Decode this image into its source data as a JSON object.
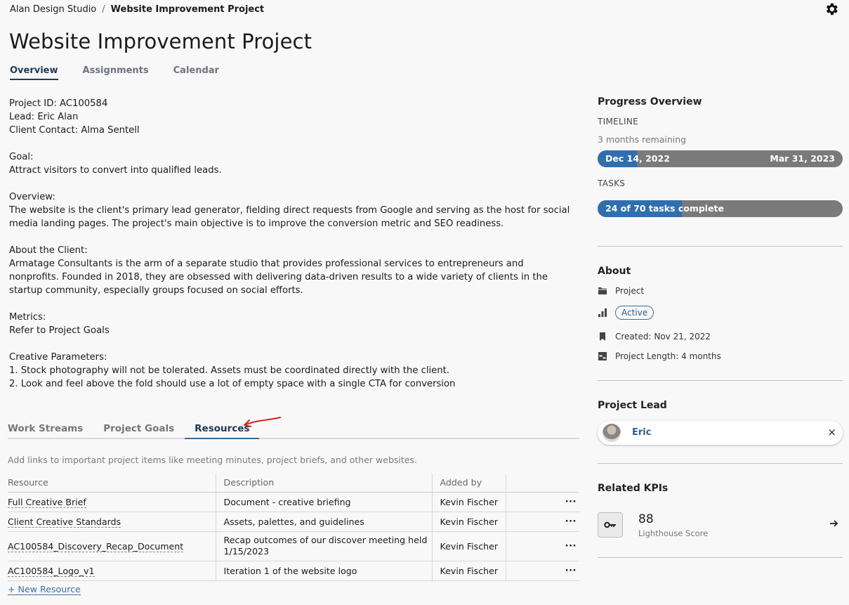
{
  "breadcrumb": {
    "studio": "Alan Design Studio",
    "separator": "/",
    "current": "Website Improvement Project"
  },
  "page_title": "Website Improvement Project",
  "top_tabs": [
    "Overview",
    "Assignments",
    "Calendar"
  ],
  "active_top_tab": "Overview",
  "description": {
    "project_id": "Project ID: AC100584",
    "lead": "Lead: Eric Alan",
    "client_contact": "Client Contact: Alma Sentell",
    "goal_label": "Goal:",
    "goal_text": "Attract visitors to convert into qualified leads.",
    "overview_label": "Overview:",
    "overview_text_1": "The website is the client's primary lead generator, fielding direct requests from Google and serving as the host for social",
    "overview_text_2": "media landing pages.  The project's main objective is to improve the conversion metric and SEO readiness.",
    "about_client_label": "About the Client:",
    "about_client_1": "Armatage Consultants is the arm of a separate studio that provides professional services to entrepreneurs and",
    "about_client_2": "nonprofits.  Founded in 2018, they are obsessed with delivering data-driven results to a wide variety of clients in the",
    "about_client_3": "startup community, especially groups focused on social efforts.",
    "metrics_label": "Metrics:",
    "metrics_text": "Refer to Project Goals",
    "creative_label": "Creative Parameters:",
    "creative_1": "1.  Stock photography will not be tolerated.  Assets must be coordinated directly with the client.",
    "creative_2": "2.  Look and feel above the fold should use a lot of empty space with a single CTA for conversion"
  },
  "sub_tabs": [
    "Work Streams",
    "Project Goals",
    "Resources"
  ],
  "active_sub_tab": "Resources",
  "resources": {
    "hint": "Add links to important project items like meeting minutes, project briefs, and other websites.",
    "columns": [
      "Resource",
      "Description",
      "Added by"
    ],
    "rows": [
      {
        "name": "Full Creative Brief",
        "description": "Document - creative briefing",
        "added_by": "Kevin Fischer",
        "menu": "···"
      },
      {
        "name": "Client Creative Standards",
        "description": "Assets, palettes, and guidelines",
        "added_by": "Kevin Fischer",
        "menu": "···"
      },
      {
        "name": "AC100584_Discovery_Recap_Document",
        "description_1": "Recap outcomes of our discover meeting held",
        "description_2": "1/15/2023",
        "added_by": "Kevin Fischer",
        "menu": "···"
      },
      {
        "name": "AC100584_Logo_v1",
        "description": "Iteration 1 of the website logo",
        "added_by": "Kevin Fischer",
        "menu": "···"
      }
    ],
    "new_resource": "+ New Resource"
  },
  "progress": {
    "title": "Progress Overview",
    "timeline_label": "TIMELINE",
    "remaining": "3 months remaining",
    "start_date": "Dec 14, 2022",
    "end_date": "Mar 31, 2023",
    "timeline_fraction": 0.16,
    "tasks_label": "TASKS",
    "tasks_text": "24 of 70 tasks complete",
    "tasks_fraction": 0.343
  },
  "about": {
    "title": "About",
    "type": "Project",
    "status": "Active",
    "created": "Created: Nov 21, 2022",
    "length": "Project Length: 4 months"
  },
  "project_lead": {
    "title": "Project Lead",
    "name": "Eric",
    "remove": "×"
  },
  "kpis": {
    "title": "Related KPIs",
    "value": "88",
    "label": "Lighthouse Score"
  },
  "colors": {
    "accent": "#2f6fb0",
    "bar_track": "#7a7a7a",
    "annotation": "#e02020"
  }
}
